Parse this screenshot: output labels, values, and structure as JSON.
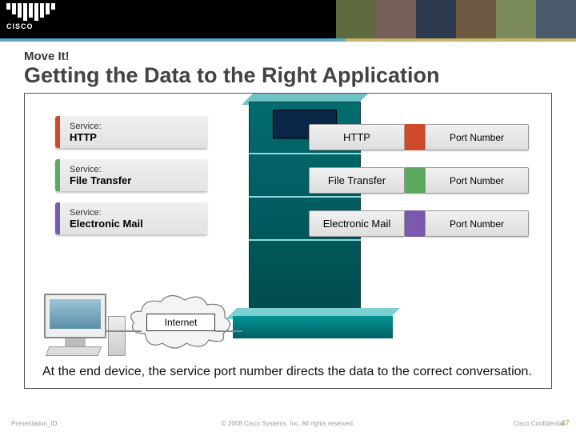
{
  "header": {
    "brand": "CISCO"
  },
  "slide": {
    "pretitle": "Move It!",
    "title": "Getting the Data to the Right Application"
  },
  "diagram": {
    "service_label": "Service:",
    "services": {
      "http": "HTTP",
      "ft": "File Transfer",
      "mail": "Electronic Mail"
    },
    "channels": {
      "http": "HTTP",
      "ft": "File Transfer",
      "mail": "Electronic Mail"
    },
    "port_label": "Port Number",
    "internet_label": "Internet",
    "caption": "At the end device, the service port number directs the data to the correct conversation."
  },
  "footer": {
    "left": "Presentation_ID",
    "center": "© 2008 Cisco Systems, Inc. All rights reserved.",
    "right": "Cisco Confidential",
    "page": "47"
  }
}
